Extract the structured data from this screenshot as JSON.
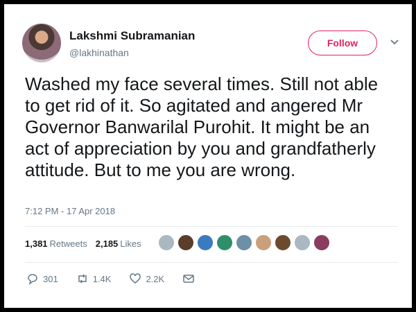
{
  "author": {
    "name": "Lakshmi Subramanian",
    "handle": "@lakhinathan"
  },
  "follow_label": "Follow",
  "tweet": {
    "lines": [
      "Washed my face several times. Still not able",
      "to get rid of it. So agitated and angered Mr",
      "Governor Banwarilal Purohit. It might be an",
      "act of appreciation by you and grandfatherly",
      "attitude. But to me you are wrong."
    ]
  },
  "timestamp": "7:12 PM - 17 Apr 2018",
  "stats": {
    "retweets_count": "1,381",
    "retweets_label": "Retweets",
    "likes_count": "2,185",
    "likes_label": "Likes"
  },
  "actions": {
    "replies": "301",
    "retweets": "1.4K",
    "likes": "2.2K"
  },
  "colors": {
    "accent": "#e0245e",
    "text": "#14171a",
    "muted": "#657786"
  }
}
